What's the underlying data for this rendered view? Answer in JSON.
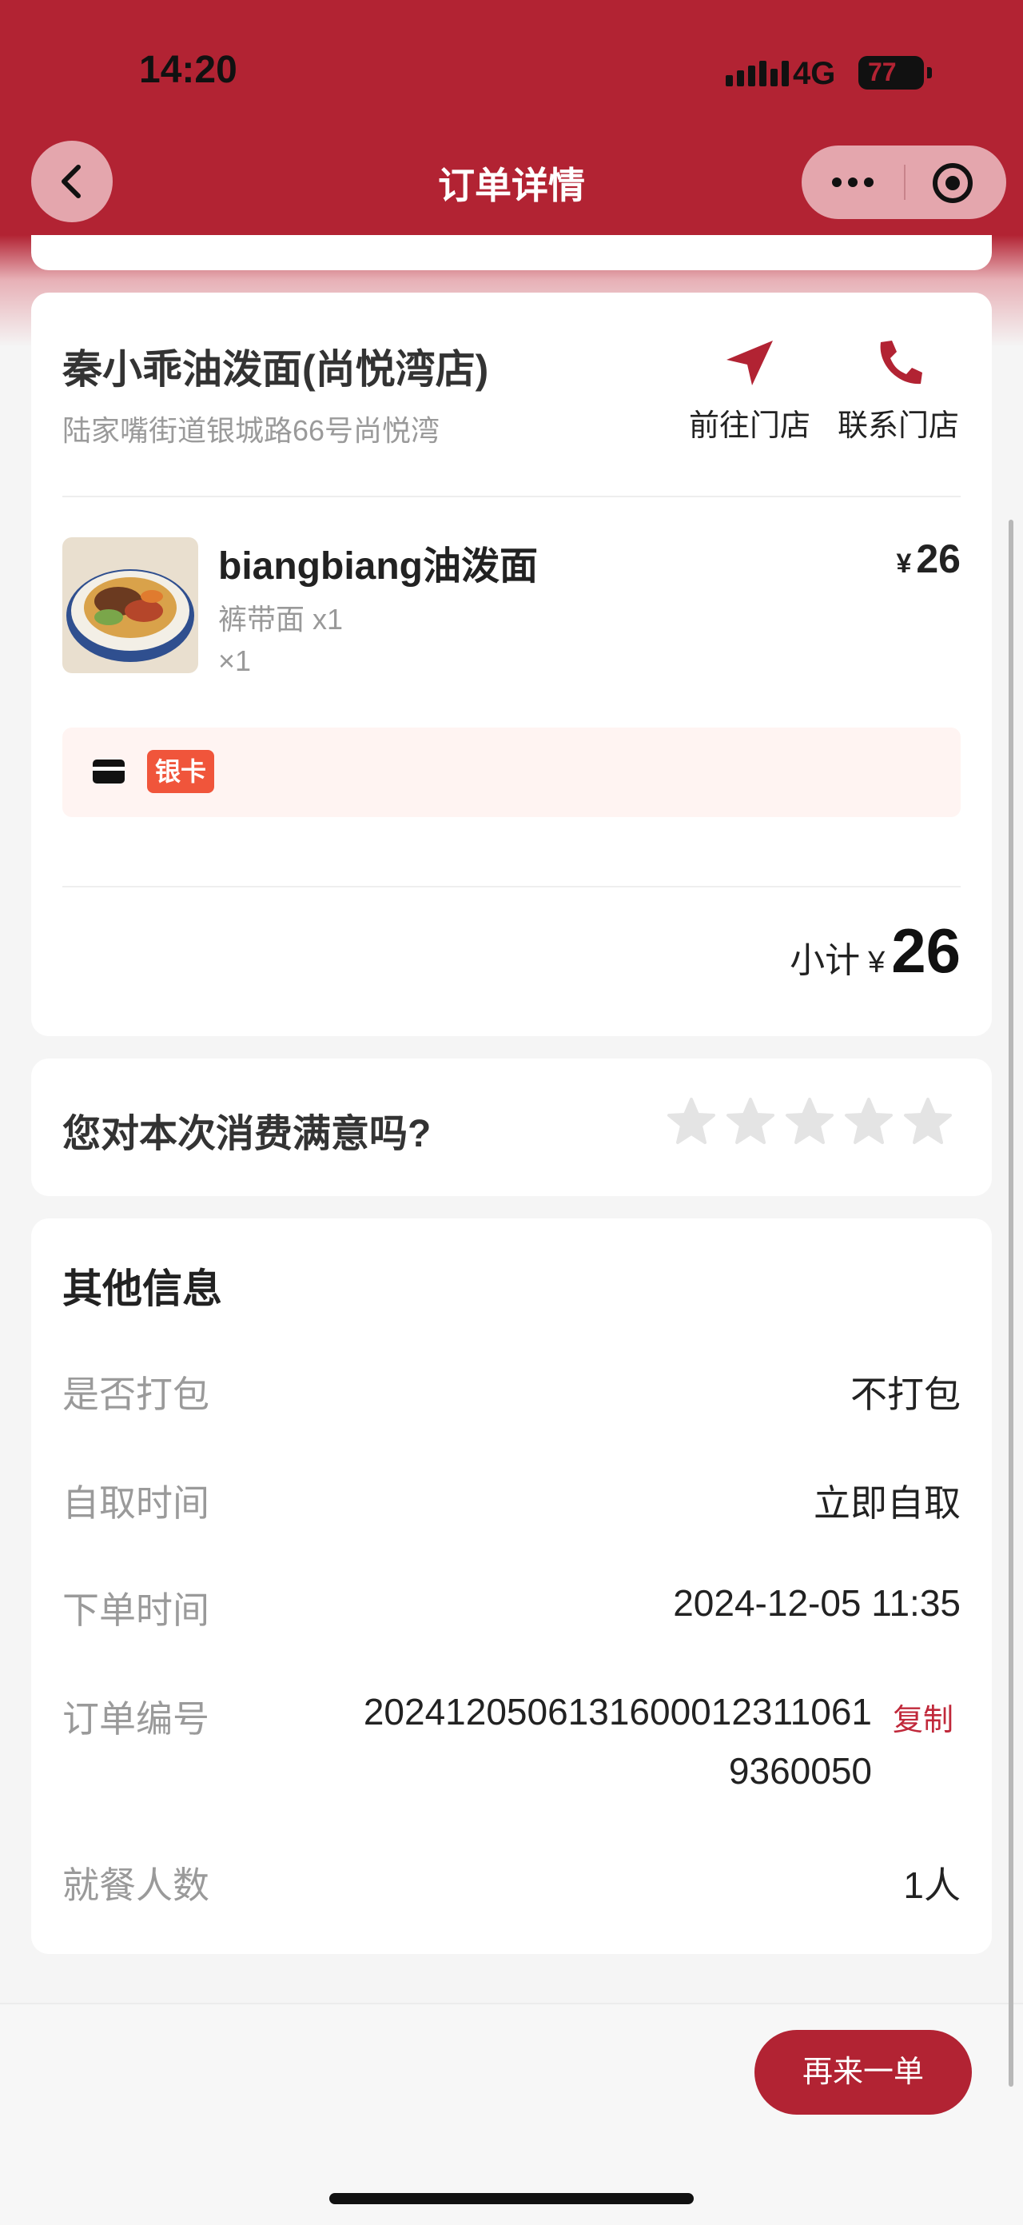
{
  "status_bar": {
    "time": "14:20",
    "network": "4G",
    "battery": "77"
  },
  "nav": {
    "title": "订单详情"
  },
  "store": {
    "name": "秦小乖油泼面(尚悦湾店)",
    "address": "陆家嘴街道银城路66号尚悦湾",
    "go_label": "前往门店",
    "call_label": "联系门店"
  },
  "item": {
    "name": "biangbiang油泼面",
    "spec": "裤带面 x1",
    "qty": "×1",
    "currency": "¥",
    "price": "26"
  },
  "payment": {
    "badge": "银卡"
  },
  "subtotal": {
    "label": "小计",
    "currency": "¥",
    "value": "26"
  },
  "rating": {
    "question": "您对本次消费满意吗?",
    "max_stars": 5,
    "selected": 0
  },
  "info": {
    "title": "其他信息",
    "packing_label": "是否打包",
    "packing_value": "不打包",
    "pickup_label": "自取时间",
    "pickup_value": "立即自取",
    "order_time_label": "下单时间",
    "order_time_value": "2024-12-05 11:35",
    "order_no_label": "订单编号",
    "order_no_line1": "2024120506131600012311061",
    "order_no_line2": "9360050",
    "copy_label": "复制",
    "diners_label": "就餐人数",
    "diners_value": "1人"
  },
  "footer": {
    "reorder_label": "再来一单"
  },
  "colors": {
    "brand": "#b22333",
    "badge": "#f0553b",
    "star": "#e4e4e4"
  }
}
